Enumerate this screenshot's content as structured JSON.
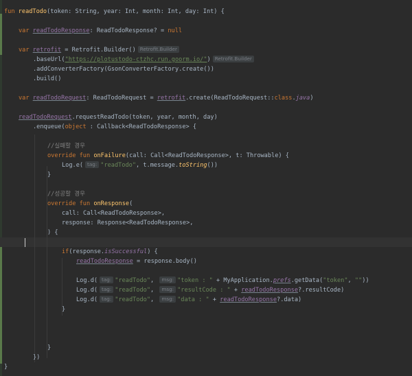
{
  "hints": {
    "retrofit_builder": "Retrofit.Builder",
    "tag": "tag:",
    "msg": "msg:"
  },
  "lines": {
    "fun": "fun",
    "readTodo": "readTodo",
    "params": "(token: String, year: Int, month: Int, day: Int) {",
    "var": "var",
    "readTodoResponse": "readTodoResponse",
    "readTodoResponse_type": ": ReadTodoResponse? = ",
    "null": "null",
    "retrofit": "retrofit",
    "retrofit_eq": " = Retrofit.Builder()",
    "baseUrl_open": ".baseUrl(",
    "url": "\"https://plotustodo-ctzhc.run.goorm.io/\"",
    "close_paren": ")",
    "addConverter": ".addConverterFactory(GsonConverterFactory.create())",
    "build": ".build()",
    "readTodoRequest": "readTodoRequest",
    "readTodoRequest_type": ": ReadTodoRequest = ",
    "create_open": ".create(ReadTodoRequest::",
    "class": "class",
    "dot": ".",
    "java": "java",
    "requestReadTodo": ".requestReadTodo(token, year, month, day)",
    "enqueue_open": ".enqueue(",
    "object": "object",
    "callback": " : Callback<ReadTodoResponse> {",
    "comment_fail": "//실패할 경우",
    "override": "override",
    "onFailure": "onFailure",
    "onFailure_params": "(call: Call<ReadTodoResponse>, t: Throwable) {",
    "loge_open": "Log.e(",
    "readTodo_str": "\"readTodo\"",
    "comma": ", ",
    "t_message": "t.message.",
    "toString": "toString",
    "close_call": "())",
    "close_brace": "}",
    "comment_success": "//성공할 경우",
    "onResponse": "onResponse",
    "open_paren": "(",
    "call_param": "call: Call<ReadTodoResponse>,",
    "response_param": "response: Response<ReadTodoResponse>,",
    "paren_brace": ") {",
    "if_open": "if",
    "response_dot": "(response.",
    "isSuccessful": "isSuccessful",
    "paren_brace2": ") {",
    "assign_body": " = response.body()",
    "logd_open": "Log.d(",
    "token_str": "\"token : \"",
    "plus_app": " + MyApplication.",
    "prefs": "prefs",
    "getData": ".getData(",
    "token_key": "\"token\"",
    "empty_str": "\"\"",
    "close2": "))",
    "resultCode_str": "\"resultCode : \"",
    "plus": " + ",
    "resultCode_tail": "?.resultCode)",
    "data_str": "\"data : \"",
    "data_tail": "?.data)",
    "close_all": "})",
    "final_brace": "}"
  }
}
